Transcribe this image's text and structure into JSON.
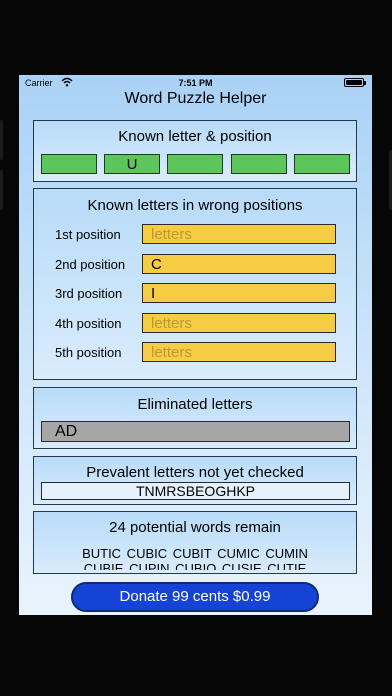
{
  "status_bar": {
    "carrier": "Carrier",
    "time": "7:51 PM"
  },
  "app": {
    "title": "Word Puzzle Helper"
  },
  "known_position": {
    "title": "Known letter & position",
    "letters": [
      "",
      "U",
      "",
      "",
      ""
    ]
  },
  "wrong_positions": {
    "title": "Known letters in wrong positions",
    "rows": [
      {
        "label": "1st position",
        "value": "",
        "placeholder": "letters"
      },
      {
        "label": "2nd position",
        "value": "C",
        "placeholder": "letters"
      },
      {
        "label": "3rd position",
        "value": "I",
        "placeholder": "letters"
      },
      {
        "label": "4th position",
        "value": "",
        "placeholder": "letters"
      },
      {
        "label": "5th position",
        "value": "",
        "placeholder": "letters"
      }
    ]
  },
  "eliminated": {
    "title": "Eliminated letters",
    "value": "AD"
  },
  "prevalent": {
    "title": "Prevalent letters not yet checked",
    "value": "TNMRSBEOGHKP"
  },
  "words": {
    "title": "24 potential words remain",
    "line1": "BUTIC  CUBIC  CUBIT  CUMIC  CUMIN",
    "line2": "CUBIE  CUPIN  CUBIO  CUSIE  CUTIE"
  },
  "donate": {
    "label": "Donate 99 cents    $0.99"
  },
  "colors": {
    "known_cell_green": "#5cc55c",
    "input_yellow": "#f6cc44",
    "eliminated_gray": "#a6a6a6",
    "donate_blue": "#1543d6"
  },
  "icons": [
    "wifi-icon",
    "battery-icon"
  ]
}
